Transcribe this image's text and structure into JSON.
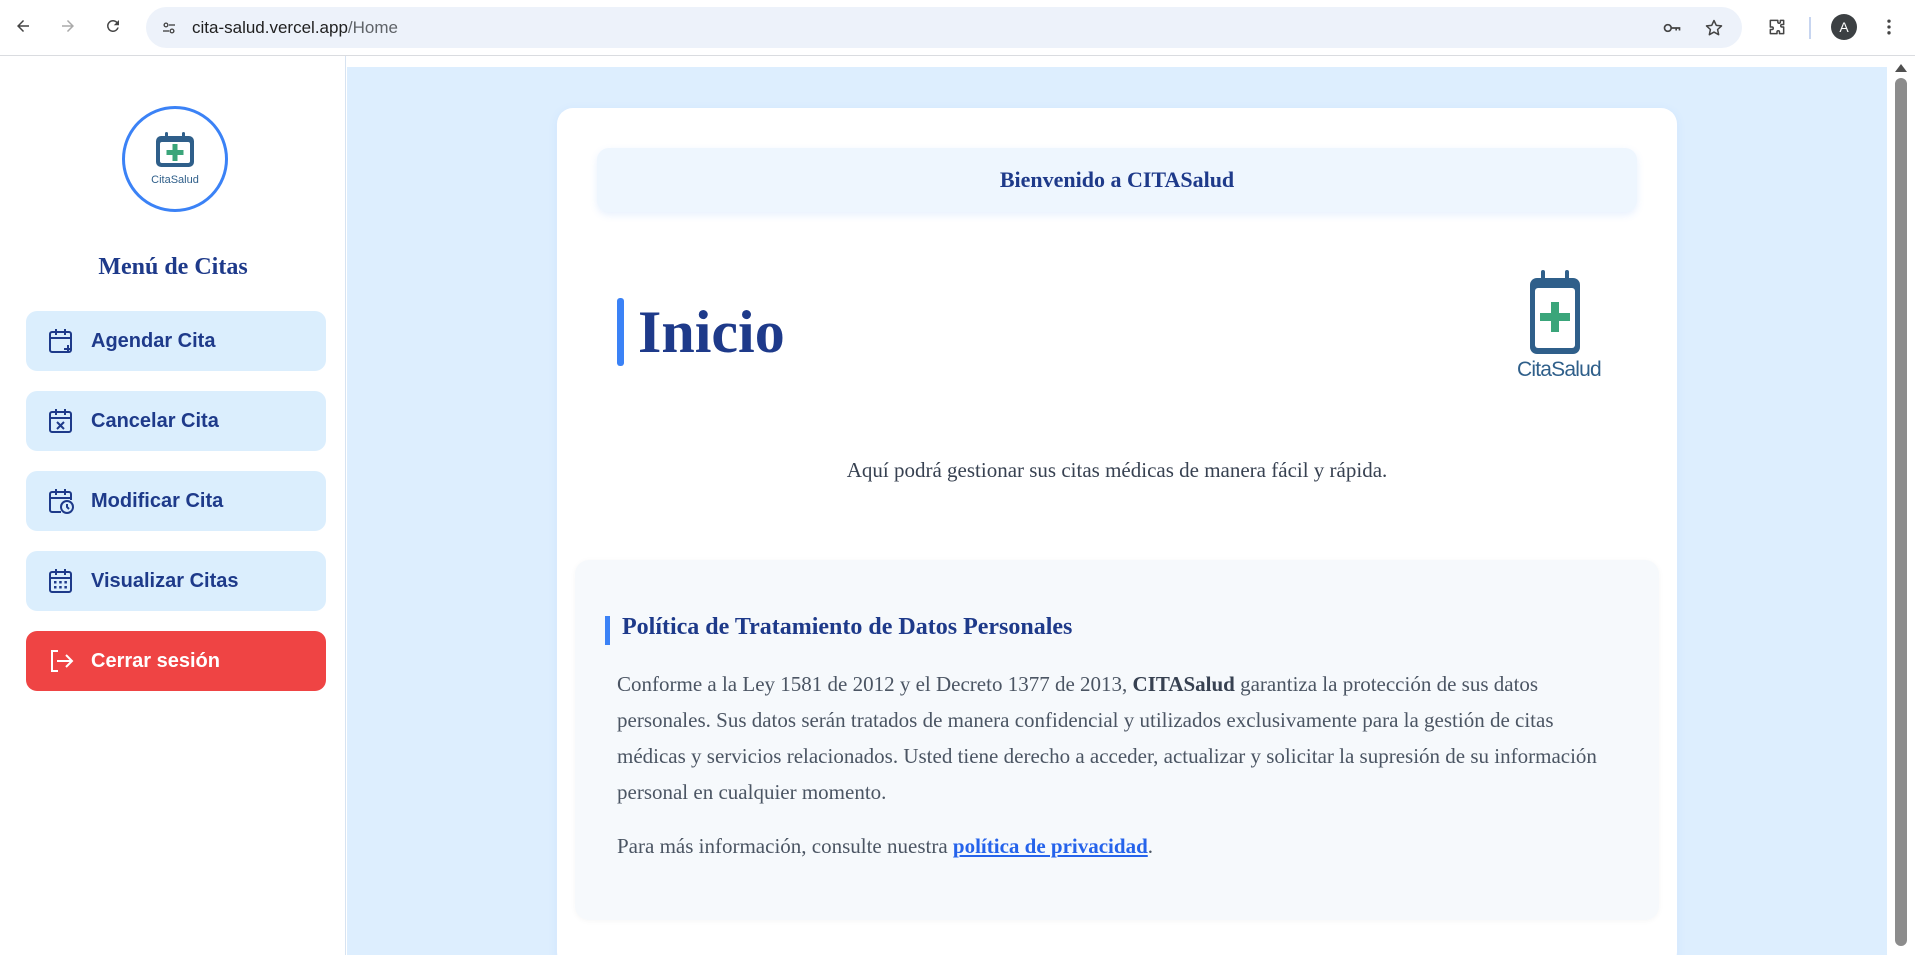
{
  "browser": {
    "url_host": "cita-salud.vercel.app",
    "url_path": "/Home",
    "avatar_initial": "A"
  },
  "sidebar": {
    "logo_text": "CitaSalud",
    "menu_title": "Menú de Citas",
    "items": [
      {
        "label": "Agendar Cita",
        "icon": "calendar-plus-icon"
      },
      {
        "label": "Cancelar Cita",
        "icon": "calendar-x-icon"
      },
      {
        "label": "Modificar Cita",
        "icon": "calendar-clock-icon"
      },
      {
        "label": "Visualizar Citas",
        "icon": "calendar-grid-icon"
      },
      {
        "label": "Cerrar sesión",
        "icon": "logout-icon"
      }
    ]
  },
  "main": {
    "welcome": "Bienvenido a CITASalud",
    "title": "Inicio",
    "brand_text": "CitaSalud",
    "subtitle": "Aquí podrá gestionar sus citas médicas de manera fácil y rápida.",
    "policy": {
      "title": "Política de Tratamiento de Datos Personales",
      "body_pre": "Conforme a la Ley 1581 de 2012 y el Decreto 1377 de 2013,",
      "body_brand": "CITASalud",
      "body_post": "garantiza la protección de sus datos personales. Sus datos serán tratados de manera confidencial y utilizados exclusivamente para la gestión de citas médicas y servicios relacionados. Usted tiene derecho a acceder, actualizar y solicitar la supresión de su información personal en cualquier momento.",
      "more_pre": "Para más información, consulte nuestra",
      "more_link": "política de privacidad",
      "more_post": "."
    }
  },
  "colors": {
    "accent": "#3b82f6",
    "navy": "#1e3a8a",
    "menu_bg": "#dbeefd",
    "logout_bg": "#ef4444",
    "main_bg": "#ddeefe",
    "brand_green": "#3aa57a"
  }
}
